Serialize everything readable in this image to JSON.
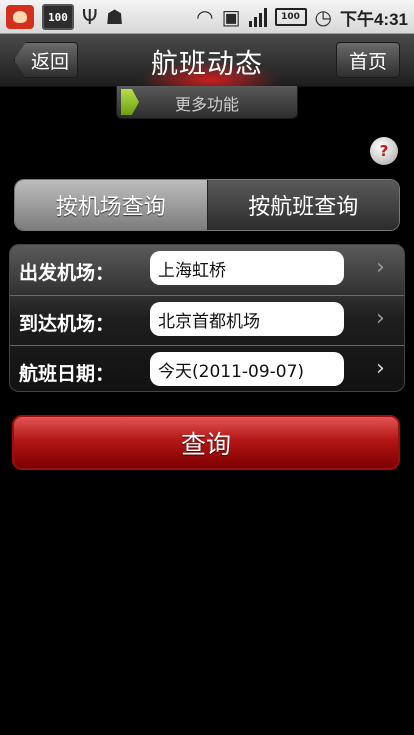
{
  "status_bar": {
    "battery_badge": "100",
    "battery_level": "100",
    "time": "下午4:31"
  },
  "header": {
    "title": "航班动态",
    "back_label": "返回",
    "home_label": "首页"
  },
  "more_functions": {
    "label": "更多功能"
  },
  "help": {
    "symbol": "?"
  },
  "tabs": [
    {
      "label": "按机场查询",
      "active": true
    },
    {
      "label": "按航班查询",
      "active": false
    }
  ],
  "form": {
    "departure": {
      "label": "出发机场：",
      "value": "上海虹桥"
    },
    "arrival": {
      "label": "到达机场：",
      "value": "北京首都机场"
    },
    "date": {
      "label": "航班日期：",
      "value": "今天(2011-09-07)"
    }
  },
  "query_button": {
    "label": "查询"
  },
  "colors": {
    "accent_red": "#b41616",
    "background": "#000000"
  }
}
